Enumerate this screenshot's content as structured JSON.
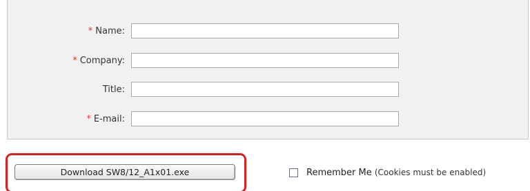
{
  "form": {
    "fields": [
      {
        "label": "Name:",
        "required": true,
        "required_mark": "*",
        "value": ""
      },
      {
        "label": "Company:",
        "required": true,
        "required_mark": "*",
        "value": ""
      },
      {
        "label": "Title:",
        "required": false,
        "required_mark": "",
        "value": ""
      },
      {
        "label": "E-mail:",
        "required": true,
        "required_mark": "*",
        "value": ""
      }
    ]
  },
  "download_button": {
    "label": "Download SW8/12_A1x01.exe"
  },
  "remember_me": {
    "checked": false,
    "label": "Remember Me",
    "note": "(Cookies must be enabled)"
  },
  "colors": {
    "required_mark": "#e2372b",
    "highlight_border": "#d61f1f",
    "panel_background": "#f1f1f1"
  }
}
